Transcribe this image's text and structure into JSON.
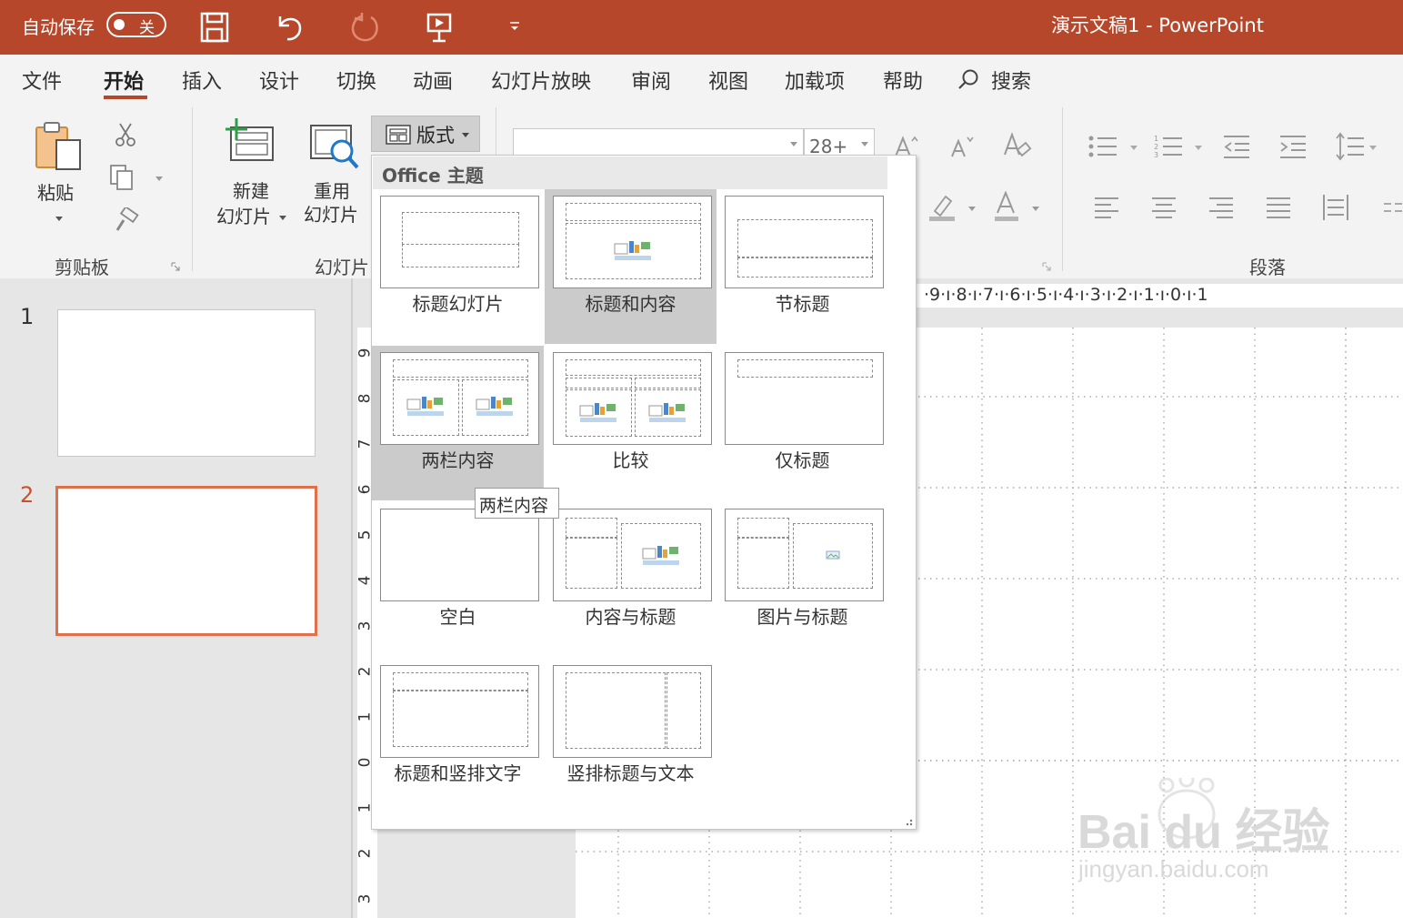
{
  "titlebar": {
    "autosave_label": "自动保存",
    "autosave_state": "关",
    "title": "演示文稿1  -  PowerPoint",
    "color": "#b7472a"
  },
  "tabs": [
    {
      "label": "文件"
    },
    {
      "label": "开始"
    },
    {
      "label": "插入"
    },
    {
      "label": "设计"
    },
    {
      "label": "切换"
    },
    {
      "label": "动画"
    },
    {
      "label": "幻灯片放映"
    },
    {
      "label": "审阅"
    },
    {
      "label": "视图"
    },
    {
      "label": "加载项"
    },
    {
      "label": "帮助"
    },
    {
      "label": "搜索"
    }
  ],
  "ribbon": {
    "clipboard": {
      "paste": "粘贴",
      "group": "剪贴板"
    },
    "slides": {
      "new_slide_1": "新建",
      "new_slide_2": "幻灯片",
      "reuse_1": "重用",
      "reuse_2": "幻灯片",
      "layout": "版式",
      "group": "幻灯片"
    },
    "font": {
      "size": "28+"
    },
    "paragraph": {
      "group": "段落"
    }
  },
  "layout_gallery": {
    "title": "Office 主题",
    "hover_tooltip": "两栏内容",
    "items": [
      {
        "label": "标题幻灯片"
      },
      {
        "label": "标题和内容"
      },
      {
        "label": "节标题"
      },
      {
        "label": "两栏内容"
      },
      {
        "label": "比较"
      },
      {
        "label": "仅标题"
      },
      {
        "label": "空白"
      },
      {
        "label": "内容与标题"
      },
      {
        "label": "图片与标题"
      },
      {
        "label": "标题和竖排文字"
      },
      {
        "label": "竖排标题与文本"
      }
    ]
  },
  "slides": [
    {
      "number": "1"
    },
    {
      "number": "2"
    }
  ],
  "ruler": {
    "horizontal": "·9·ı·8·ı·7·ı·6·ı·5·ı·4·ı·3·ı·2·ı·1·ı·0·ı·1",
    "vertical": [
      "9",
      "8",
      "7",
      "6",
      "5",
      "4",
      "3",
      "2",
      "1",
      "0",
      "1",
      "2",
      "3"
    ]
  },
  "watermark": {
    "line1": "Bai  du 经验",
    "line2": "jingyan.baidu.com"
  }
}
